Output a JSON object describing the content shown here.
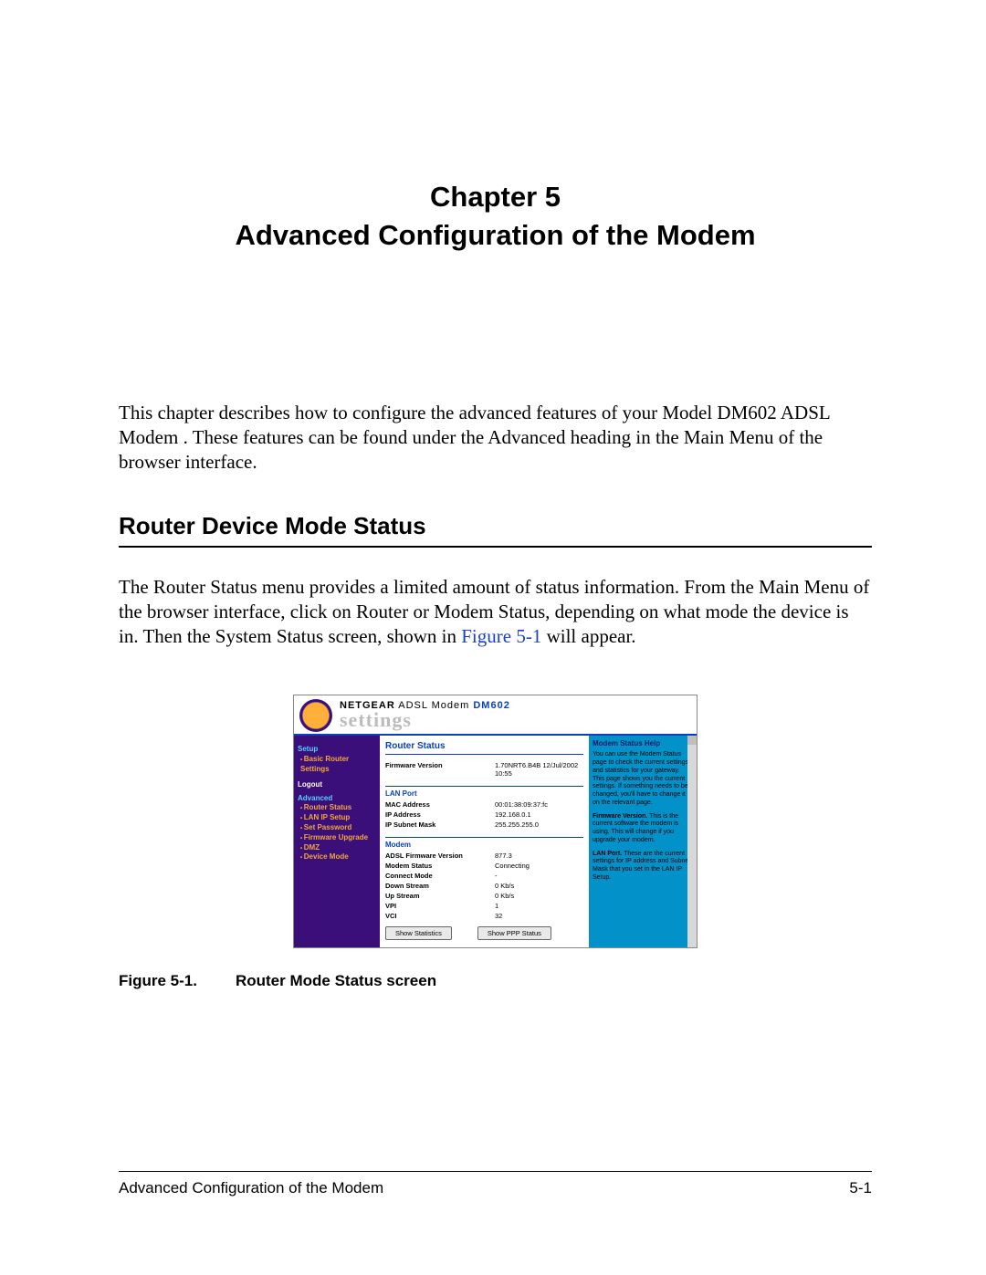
{
  "chapter": {
    "line1": "Chapter 5",
    "line2": "Advanced Configuration of the Modem"
  },
  "intro_para": "This chapter describes how to configure the advanced features of your Model DM602 ADSL Modem . These features can be found under the Advanced heading in the Main Menu of the browser interface.",
  "section1": {
    "heading": "Router Device Mode Status",
    "para_before_link": "The Router Status menu provides a limited amount of status information. From the Main Menu of the browser interface, click on Router or Modem Status, depending on what mode the device is in. Then the System Status screen, shown in ",
    "link_text": "Figure 5-1",
    "para_after_link": " will appear."
  },
  "figure": {
    "label": "Figure 5-1.",
    "caption": "Router Mode Status screen"
  },
  "footer": {
    "left": "Advanced Configuration of the Modem",
    "right": "5-1"
  },
  "screenshot": {
    "brand_prefix": "NETGEAR",
    "brand_mid": "  ADSL Modem ",
    "brand_model": "DM602",
    "settings_word": "settings",
    "sidebar": {
      "cat_setup": "Setup",
      "item_basic": "Basic Router Settings",
      "logout": "Logout",
      "cat_adv": "Advanced",
      "item_status": "Router Status",
      "item_lanip": "LAN IP Setup",
      "item_setpw": "Set Password",
      "item_fw": "Firmware Upgrade",
      "item_dmz": "DMZ",
      "item_devmode": "Device Mode"
    },
    "main": {
      "title": "Router Status",
      "fw_k": "Firmware Version",
      "fw_v": "1.70NRT6.B4B 12/Jul/2002 10:55",
      "lan_hdr": "LAN Port",
      "mac_k": "MAC Address",
      "mac_v": "00:01:38:09:37:fc",
      "ip_k": "IP Address",
      "ip_v": "192.168.0.1",
      "sub_k": "IP Subnet Mask",
      "sub_v": "255.255.255.0",
      "modem_hdr": "Modem",
      "adslfw_k": "ADSL Firmware Version",
      "adslfw_v": "877.3",
      "mstat_k": "Modem Status",
      "mstat_v": "Connecting",
      "cmode_k": "Connect Mode",
      "cmode_v": "-",
      "down_k": "Down Stream",
      "down_v": "0 Kb/s",
      "up_k": "Up Stream",
      "up_v": "0 Kb/s",
      "vpi_k": "VPI",
      "vpi_v": "1",
      "vci_k": "VCI",
      "vci_v": "32",
      "btn_stats": "Show Statistics",
      "btn_ppp": "Show PPP Status"
    },
    "help": {
      "title": "Modem Status Help",
      "p1": "You can use the Modem Status page to check the current settings and statistics for your gateway. This page shows you the current settings. If something needs to be changed, you'll have to change it on the relevant page.",
      "p2a": "Firmware Version.",
      "p2b": " This is the current software the modem is using. This will change if you upgrade your modem.",
      "p3a": "LAN Port.",
      "p3b": " These are the current settings for IP address and Subnet Mask that you set in the LAN IP Setup."
    }
  }
}
